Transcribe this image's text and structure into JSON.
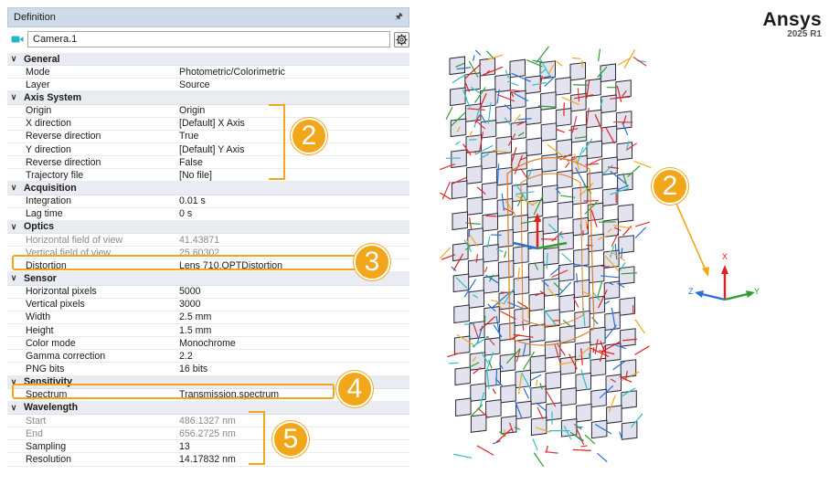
{
  "panel": {
    "title": "Definition",
    "pin": "ḗ",
    "object_name": "Camera.1"
  },
  "groups": [
    {
      "label": "General",
      "rows": [
        {
          "name": "Mode",
          "value": "Photometric/Colorimetric"
        },
        {
          "name": "Layer",
          "value": "Source"
        }
      ]
    },
    {
      "label": "Axis System",
      "rows": [
        {
          "name": "Origin",
          "value": "Origin"
        },
        {
          "name": "X direction",
          "value": "[Default] X Axis"
        },
        {
          "name": "Reverse direction",
          "value": "True"
        },
        {
          "name": "Y direction",
          "value": "[Default] Y Axis"
        },
        {
          "name": "Reverse direction",
          "value": "False"
        },
        {
          "name": "Trajectory file",
          "value": "[No file]"
        }
      ]
    },
    {
      "label": "Acquisition",
      "rows": [
        {
          "name": "Integration",
          "value": "0.01 s"
        },
        {
          "name": "Lag time",
          "value": "0 s"
        }
      ]
    },
    {
      "label": "Optics",
      "rows": [
        {
          "name": "Horizontal field of view",
          "value": "41.43871",
          "disabled": true
        },
        {
          "name": "Vertical field of view",
          "value": "25.60302",
          "disabled": true
        },
        {
          "name": "Distortion",
          "value": "Lens 710.OPTDistortion"
        }
      ]
    },
    {
      "label": "Sensor",
      "rows": [
        {
          "name": "Horizontal pixels",
          "value": "5000"
        },
        {
          "name": "Vertical pixels",
          "value": "3000"
        },
        {
          "name": "Width",
          "value": "2.5 mm"
        },
        {
          "name": "Height",
          "value": "1.5 mm"
        },
        {
          "name": "Color mode",
          "value": "Monochrome"
        },
        {
          "name": "Gamma correction",
          "value": "2.2"
        },
        {
          "name": "PNG bits",
          "value": "16 bits"
        }
      ]
    },
    {
      "label": "Sensitivity",
      "rows": [
        {
          "name": "Spectrum",
          "value": "Transmission.spectrum"
        }
      ]
    },
    {
      "label": "Wavelength",
      "rows": [
        {
          "name": "Start",
          "value": "486.1327 nm",
          "disabled": true
        },
        {
          "name": "End",
          "value": "656.2725 nm",
          "disabled": true
        },
        {
          "name": "Sampling",
          "value": "13"
        },
        {
          "name": "Resolution",
          "value": "14.17832 nm"
        }
      ]
    }
  ],
  "callouts": {
    "axis_system": "2",
    "distortion": "3",
    "spectrum": "4",
    "wavelength": "5",
    "axis_widget": "2"
  },
  "logo": {
    "word": "Ansys",
    "release": "2025 R1"
  },
  "axes": {
    "x": "X",
    "y": "Y",
    "z": "Z"
  },
  "colors": {
    "accent": "#f2a71b",
    "axis_x": "#e02020",
    "axis_y": "#2f9e2f",
    "axis_z": "#2a6fd6"
  }
}
